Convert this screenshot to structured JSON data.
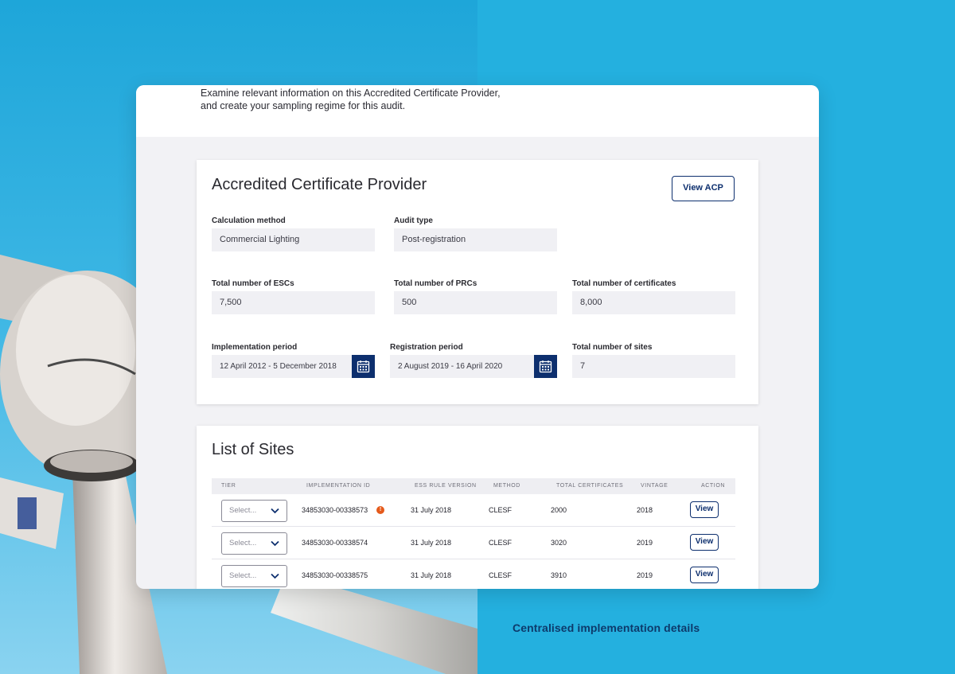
{
  "intro": "Examine relevant information on this Accredited Certificate Provider, and create your sampling regime for this audit.",
  "acp": {
    "title": "Accredited Certificate Provider",
    "view_button": "View ACP",
    "fields": {
      "calc_method": {
        "label": "Calculation method",
        "value": "Commercial Lighting"
      },
      "audit_type": {
        "label": "Audit type",
        "value": "Post-registration"
      },
      "total_escs": {
        "label": "Total number of ESCs",
        "value": "7,500"
      },
      "total_prcs": {
        "label": "Total number of PRCs",
        "value": "500"
      },
      "total_certs": {
        "label": "Total number of certificates",
        "value": "8,000"
      },
      "impl_period": {
        "label": "Implementation period",
        "value": "12 April 2012 - 5 December 2018"
      },
      "reg_period": {
        "label": "Registration period",
        "value": "2 August 2019 - 16 April 2020"
      },
      "total_sites": {
        "label": "Total number of sites",
        "value": "7"
      }
    }
  },
  "sites": {
    "title": "List of Sites",
    "columns": [
      "Tier",
      "Implementation ID",
      "ESS Rule Version",
      "Method",
      "Total Certificates",
      "Vintage",
      "Action"
    ],
    "rows": [
      {
        "tier": "Select...",
        "impl_id": "34853030-00338573",
        "warning": "!",
        "rule_version": "31 July 2018",
        "method": "CLESF",
        "total": "2000",
        "vintage": "2018",
        "action": "View"
      },
      {
        "tier": "Select...",
        "impl_id": "34853030-00338574",
        "rule_version": "31 July 2018",
        "method": "CLESF",
        "total": "3020",
        "vintage": "2019",
        "action": "View"
      },
      {
        "tier": "Select...",
        "impl_id": "34853030-00338575",
        "rule_version": "31 July 2018",
        "method": "CLESF",
        "total": "3910",
        "vintage": "2019",
        "action": "View"
      }
    ]
  },
  "caption": "Centralised implementation details",
  "colors": {
    "navy": "#0d2f6e",
    "sky": "#24b0df",
    "warning": "#e55a1b"
  },
  "icons": {
    "calendar": "calendar-icon",
    "chevron": "chevron-down-icon",
    "warning": "warning-icon"
  }
}
